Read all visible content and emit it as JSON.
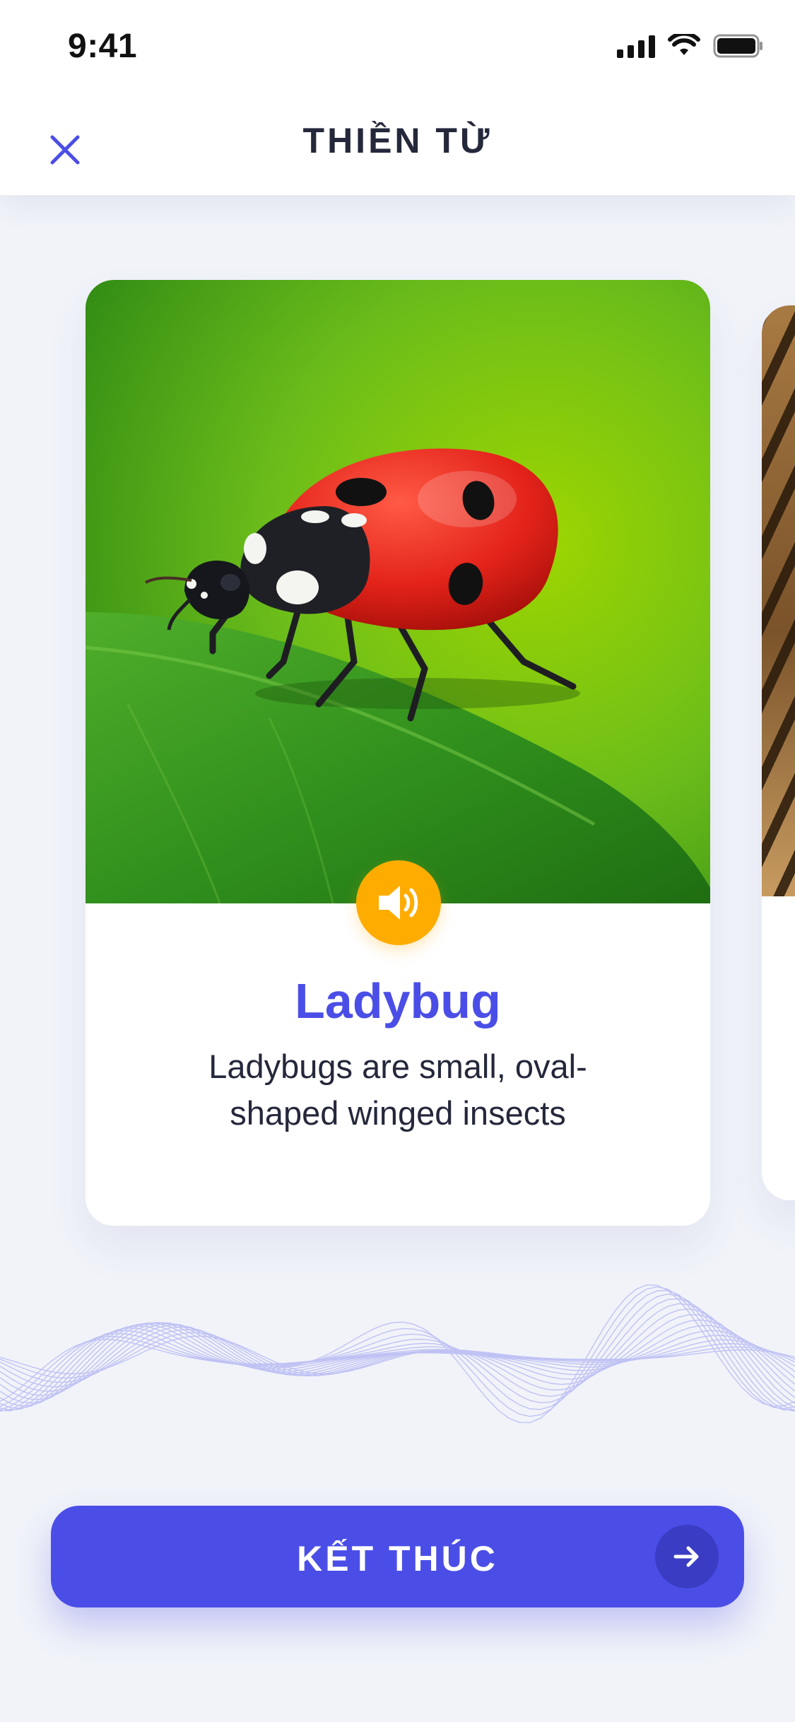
{
  "status_bar": {
    "time": "9:41"
  },
  "header": {
    "title": "THIỀN TỪ",
    "close_icon": "close-icon"
  },
  "card": {
    "image_subject": "ladybug-on-leaf-photo",
    "sound_icon": "speaker-icon",
    "title": "Ladybug",
    "description": "Ladybugs are small, oval-shaped winged insects"
  },
  "next_card": {
    "image_subject": "tiger-photo"
  },
  "footer": {
    "finish_label": "KẾT THÚC",
    "arrow_icon": "arrow-right-icon"
  },
  "colors": {
    "accent": "#4b4ee6",
    "sound_button": "#ffac00",
    "background": "#f1f3f9",
    "text": "#25283b"
  }
}
